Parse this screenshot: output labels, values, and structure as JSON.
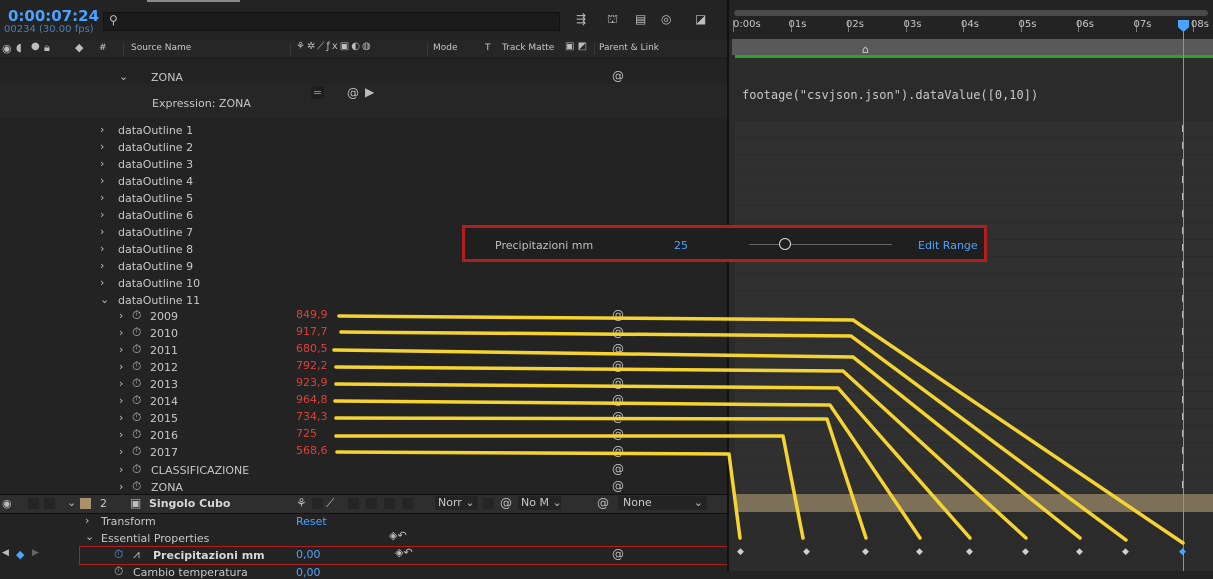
{
  "timecode": "0:00:07:24",
  "frame_info": "00234 (30.00 fps)",
  "search": {
    "placeholder": ""
  },
  "columns": {
    "hash": "#",
    "source_name": "Source Name",
    "mode": "Mode",
    "t": "T",
    "track_matte": "Track Matte",
    "parent_link": "Parent & Link"
  },
  "ruler": [
    "0:00s",
    "01s",
    "02s",
    "03s",
    "04s",
    "05s",
    "06s",
    "07s",
    "08s"
  ],
  "zona_top": "ZONA",
  "expression_label": "Expression: ZONA",
  "expression_code": "footage(\"csvjson.json\").dataValue([0,10])",
  "outlines": [
    "dataOutline 1",
    "dataOutline 2",
    "dataOutline 3",
    "dataOutline 4",
    "dataOutline 5",
    "dataOutline 6",
    "dataOutline 7",
    "dataOutline 8",
    "dataOutline 9",
    "dataOutline 10",
    "dataOutline 11"
  ],
  "years": [
    {
      "year": "2009",
      "value": "849,9"
    },
    {
      "year": "2010",
      "value": "917,7"
    },
    {
      "year": "2011",
      "value": "680,5"
    },
    {
      "year": "2012",
      "value": "792,2"
    },
    {
      "year": "2013",
      "value": "923,9"
    },
    {
      "year": "2014",
      "value": "964,8"
    },
    {
      "year": "2015",
      "value": "734,3"
    },
    {
      "year": "2016",
      "value": "725"
    },
    {
      "year": "2017",
      "value": "568,6"
    }
  ],
  "classificazione": "CLASSIFICAZIONE",
  "zona_bottom": "ZONA",
  "layer2": {
    "number": "2",
    "name": "Singolo Cubo",
    "mode": "Norr",
    "matte": "No M",
    "parent": "None"
  },
  "transform": {
    "label": "Transform",
    "reset": "Reset"
  },
  "essential": {
    "label": "Essential Properties"
  },
  "precip_row": {
    "label": "Precipitazioni mm",
    "value": "0,00"
  },
  "cut_row": {
    "label": "Cambio temperatura",
    "value": "0,00"
  },
  "popup": {
    "label": "Precipitazioni mm",
    "value": "25",
    "edit_range": "Edit Range",
    "slider_fraction": 0.25
  },
  "colors": {
    "accent": "#4aa3ff",
    "value_red": "#e0403a",
    "annotation_yellow": "#f5d432",
    "highlight_red": "#b01e1e",
    "layer_tan": "#7d7058"
  },
  "icons": [
    "search-icon",
    "stopwatch-icon",
    "chevron-right-icon",
    "chevron-down-icon",
    "eye-icon",
    "lock-icon",
    "label-icon",
    "pickwhip-icon",
    "keyframe-icon"
  ]
}
